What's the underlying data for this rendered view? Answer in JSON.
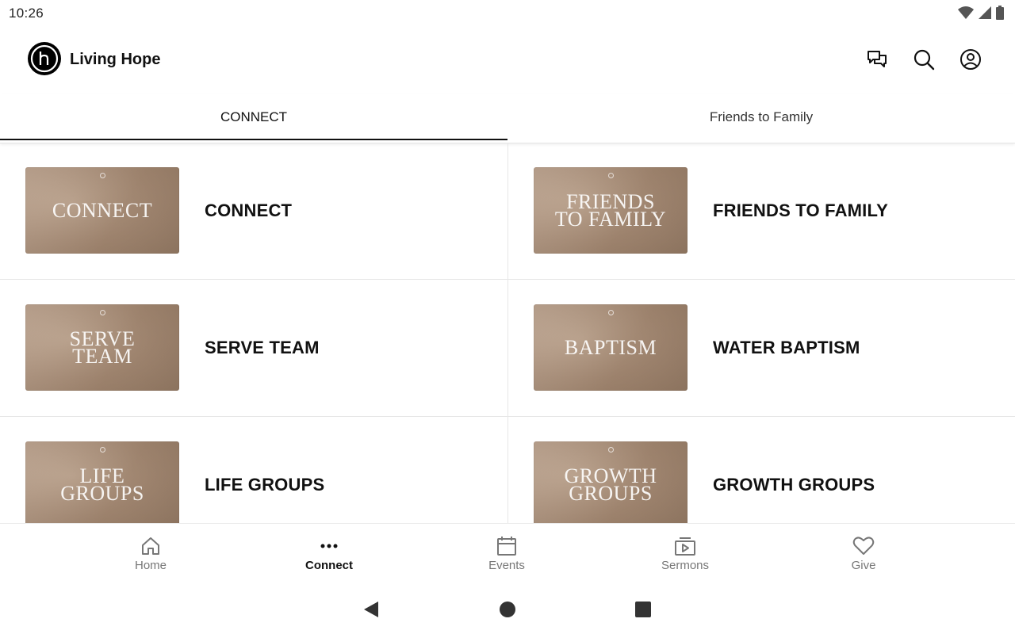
{
  "status_bar": {
    "time": "10:26"
  },
  "app": {
    "title": "Living Hope"
  },
  "tabs": [
    {
      "label": "CONNECT",
      "active": true
    },
    {
      "label": "Friends to Family",
      "active": false
    }
  ],
  "items": [
    {
      "thumb_text": "CONNECT",
      "label": "CONNECT"
    },
    {
      "thumb_text": "FRIENDS\nTO FAMILY",
      "label": "FRIENDS TO FAMILY"
    },
    {
      "thumb_text": "SERVE\nTEAM",
      "label": "SERVE TEAM"
    },
    {
      "thumb_text": "BAPTISM",
      "label": "WATER BAPTISM"
    },
    {
      "thumb_text": "LIFE\nGROUPS",
      "label": "LIFE GROUPS"
    },
    {
      "thumb_text": "GROWTH\nGROUPS",
      "label": "GROWTH GROUPS"
    }
  ],
  "bottom_nav": [
    {
      "label": "Home",
      "icon": "home-icon"
    },
    {
      "label": "Connect",
      "icon": "more-dots-icon",
      "active": true
    },
    {
      "label": "Events",
      "icon": "calendar-icon"
    },
    {
      "label": "Sermons",
      "icon": "video-library-icon"
    },
    {
      "label": "Give",
      "icon": "heart-icon"
    }
  ],
  "colors": {
    "accent": "#111111",
    "thumb": "#a98e78",
    "inactive_text": "#777777"
  }
}
